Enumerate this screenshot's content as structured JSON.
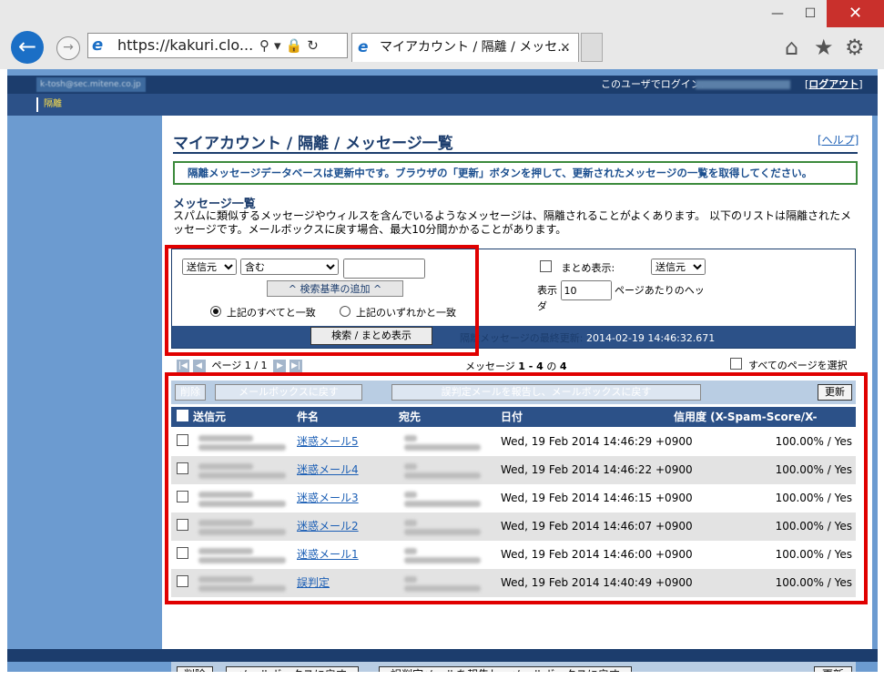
{
  "browser": {
    "url": "https://kakuri.clo...",
    "tab_title": "マイアカウント / 隔離 / メッセ...",
    "tab_close": "×",
    "back": "←",
    "forward": "→",
    "addr_icons": "⚲▾🔒↻",
    "win_minimize": "—",
    "win_maximize": "☐",
    "win_close": "✕",
    "ie_glyph": "e",
    "home_icon": "⌂",
    "star_icon": "★",
    "gear_icon": "⚙"
  },
  "header": {
    "user_email": "k-tosh@sec.mitene.co.jp",
    "login_label": "このユーザでログイン:",
    "logout_open": "[",
    "logout_label": "ログアウト",
    "logout_close": "]",
    "nav_quarantine": "隔離"
  },
  "main": {
    "title": "マイアカウント / 隔離 / メッセージ一覧",
    "help": "[ヘルプ]",
    "notice": "隔離メッセージデータベースは更新中です。ブラウザの「更新」ボタンを押して、更新されたメッセージの一覧を取得してください。",
    "list_heading": "メッセージ一覧",
    "list_desc": "スパムに類似するメッセージやウィルスを含んでいるようなメッセージは、隔離されることがよくあります。 以下のリストは隔離されたメッセージです。メールボックスに戻す場合、最大10分間かかることがあります。"
  },
  "filter": {
    "field_select": "送信元",
    "op_select": "含む",
    "search_value": "",
    "add_criteria": "^ 検索基準の追加 ^",
    "match_all": "上記のすべてと一致",
    "match_any": "上記のいずれかと一致",
    "search_button": "検索 / まとめ表示",
    "last_update_label": "隔離メッセージの最終更新: ",
    "last_update": "2014-02-19 14:46:32.671",
    "summary_label": "まとめ表示:",
    "summary_select": "送信元",
    "show_label": "表示",
    "per_page": "10",
    "per_page_suffix": "ページあたりのヘッダ"
  },
  "pager": {
    "page_label": "ページ 1 / 1",
    "first": "|◀",
    "prev": "◀",
    "next": "▶",
    "last": "▶|",
    "count_prefix": "メッセージ ",
    "count_range": "1 - 4",
    "count_mid": " の ",
    "count_total": "4",
    "select_all_pages": "すべてのページを選択"
  },
  "actions": {
    "delete": "削除",
    "return_mailbox": "メールボックスに戻す",
    "report_false": "誤判定メールを報告し、メールボックスに戻す",
    "refresh": "更新"
  },
  "table": {
    "headers": [
      "送信元",
      "件名",
      "宛先",
      "日付",
      "信用度 (X-Spam-Score/X-Spam)"
    ],
    "rows": [
      {
        "subject": "迷惑メール5",
        "date": "Wed, 19 Feb 2014 14:46:29 +0900",
        "score": "100.00% / Yes"
      },
      {
        "subject": "迷惑メール4",
        "date": "Wed, 19 Feb 2014 14:46:22 +0900",
        "score": "100.00% / Yes"
      },
      {
        "subject": "迷惑メール3",
        "date": "Wed, 19 Feb 2014 14:46:15 +0900",
        "score": "100.00% / Yes"
      },
      {
        "subject": "迷惑メール2",
        "date": "Wed, 19 Feb 2014 14:46:07 +0900",
        "score": "100.00% / Yes"
      },
      {
        "subject": "迷惑メール1",
        "date": "Wed, 19 Feb 2014 14:46:00 +0900",
        "score": "100.00% / Yes"
      },
      {
        "subject": "誤判定",
        "date": "Wed, 19 Feb 2014 14:40:49 +0900",
        "score": "100.00% / Yes"
      }
    ]
  },
  "colors": {
    "navy": "#1c3d6d",
    "band": "#2c5188",
    "page_bg": "#6c9bd0",
    "highlight": "#e00000"
  }
}
